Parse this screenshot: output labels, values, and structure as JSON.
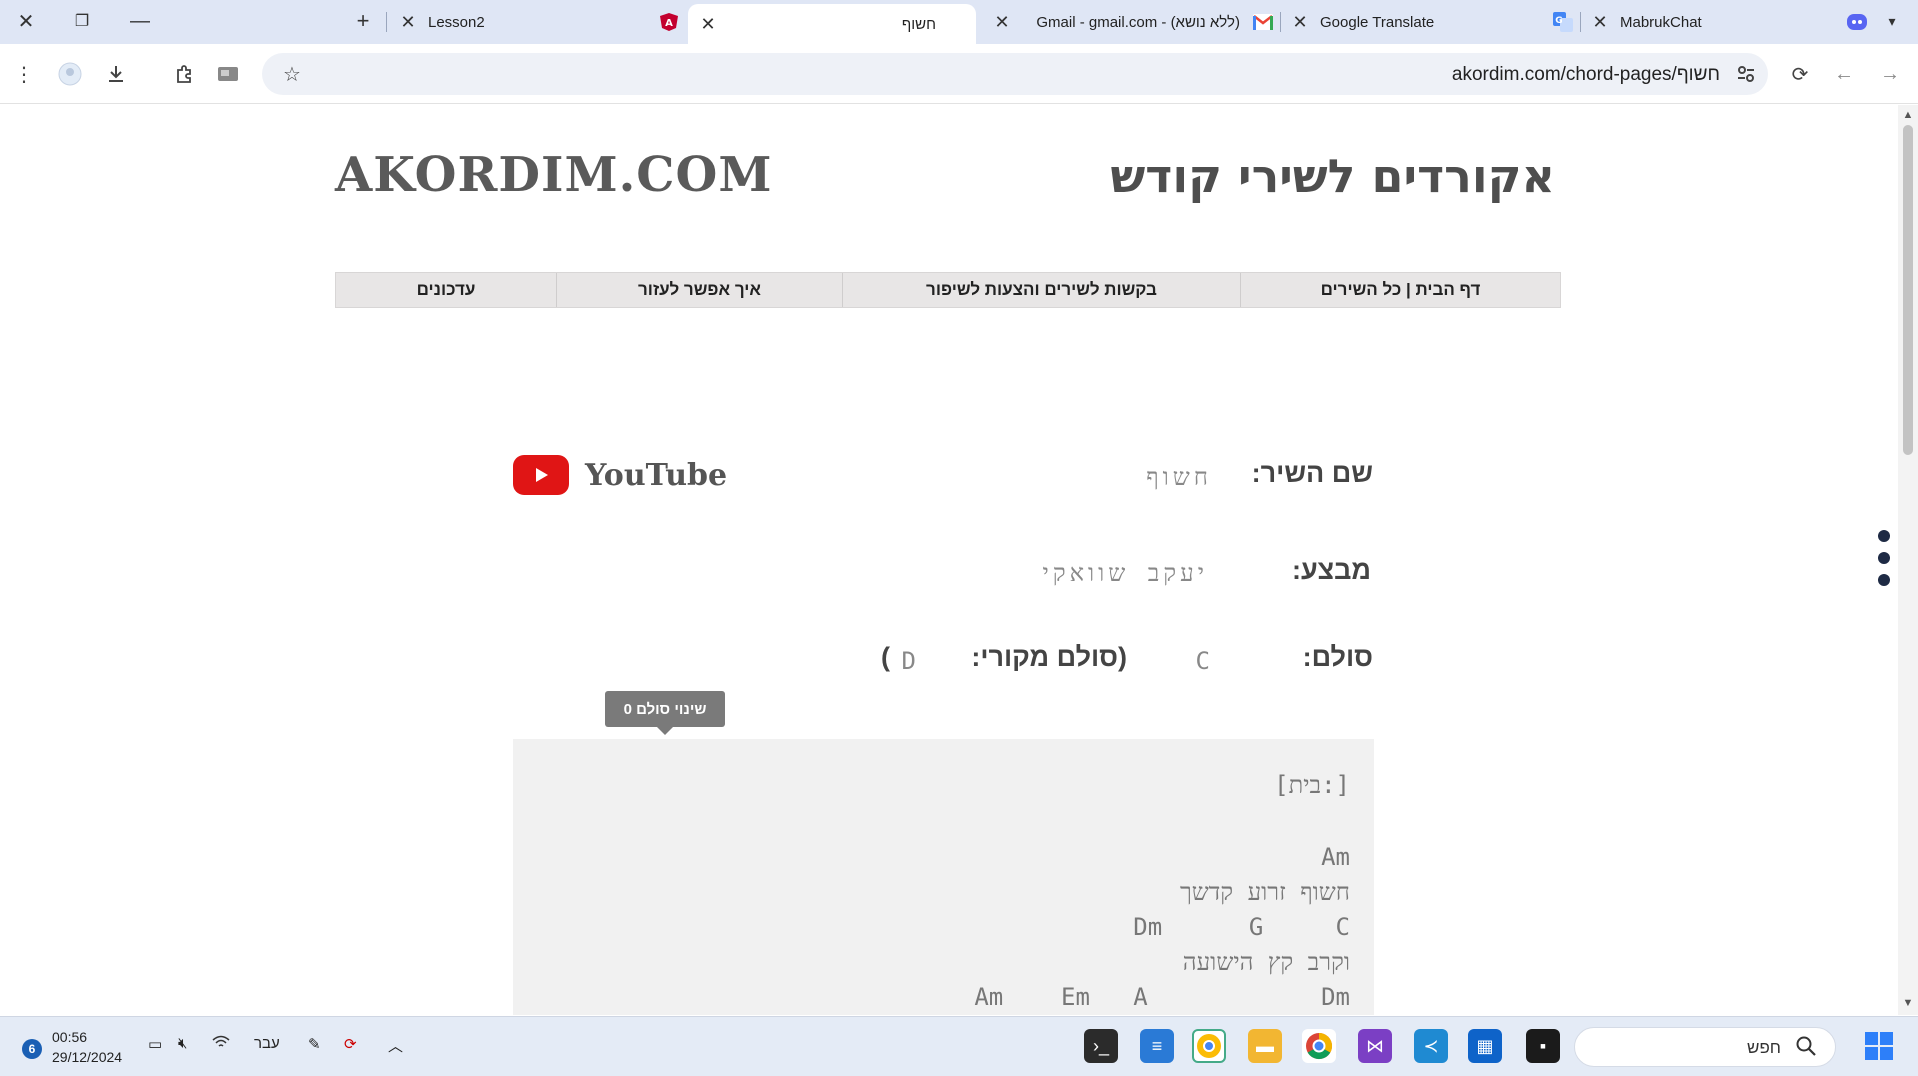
{
  "browser": {
    "tabs": [
      {
        "title": "Lesson2",
        "favicon": "angular-logo",
        "accent": "#c3002f"
      },
      {
        "title": "חשוף",
        "favicon": "",
        "active": true
      },
      {
        "title": "(ללא נושא) - Gmail - gmail.com",
        "favicon": "gmail-logo",
        "accent": "#ea4335"
      },
      {
        "title": "Google Translate",
        "favicon": "google-translate-logo",
        "accent": "#4285f4"
      },
      {
        "title": "MabrukChat",
        "favicon": "discord-logo",
        "accent": "#5865f2"
      }
    ],
    "url": "akordim.com/chord-pages/חשוף"
  },
  "site": {
    "title": "AKORDIM.COM",
    "heading": "אקורדים לשירי קודש",
    "nav": [
      "דף הבית | כל השירים",
      "בקשות לשירים והצעות לשיפור",
      "איך אפשר לעזור",
      "עדכונים"
    ],
    "youtube_label": "YouTube"
  },
  "song": {
    "name_label": "שם השיר:",
    "name_value": "חשוף",
    "performer_label": "מבצע:",
    "performer_value": "יעקב שוואקי",
    "key_label": "סולם:",
    "key_value": "C",
    "original_key_label": "(סולם מקורי:",
    "original_key_value": "D",
    "original_key_close": ")",
    "transpose_tooltip": "שינוי סולם 0",
    "transpose": {
      "steps": 11,
      "current_index": 5
    }
  },
  "chords": {
    "section": "[בית:]",
    "lines": [
      "Am",
      "חשוף זרוע קדשך",
      "Dm      G     C",
      "וקרב קץ הישועה",
      "Am    Em   A            Dm"
    ]
  },
  "taskbar": {
    "notification_count": "6",
    "time": "00:56",
    "date": "29/12/2024",
    "language": "עבר",
    "search_placeholder": "חפש"
  },
  "colors": {
    "tab_bar": "#dfe6f5",
    "nav_bg": "#e8e6e6",
    "youtube_red": "#e01515",
    "chord_bg": "#f1f1f1"
  }
}
